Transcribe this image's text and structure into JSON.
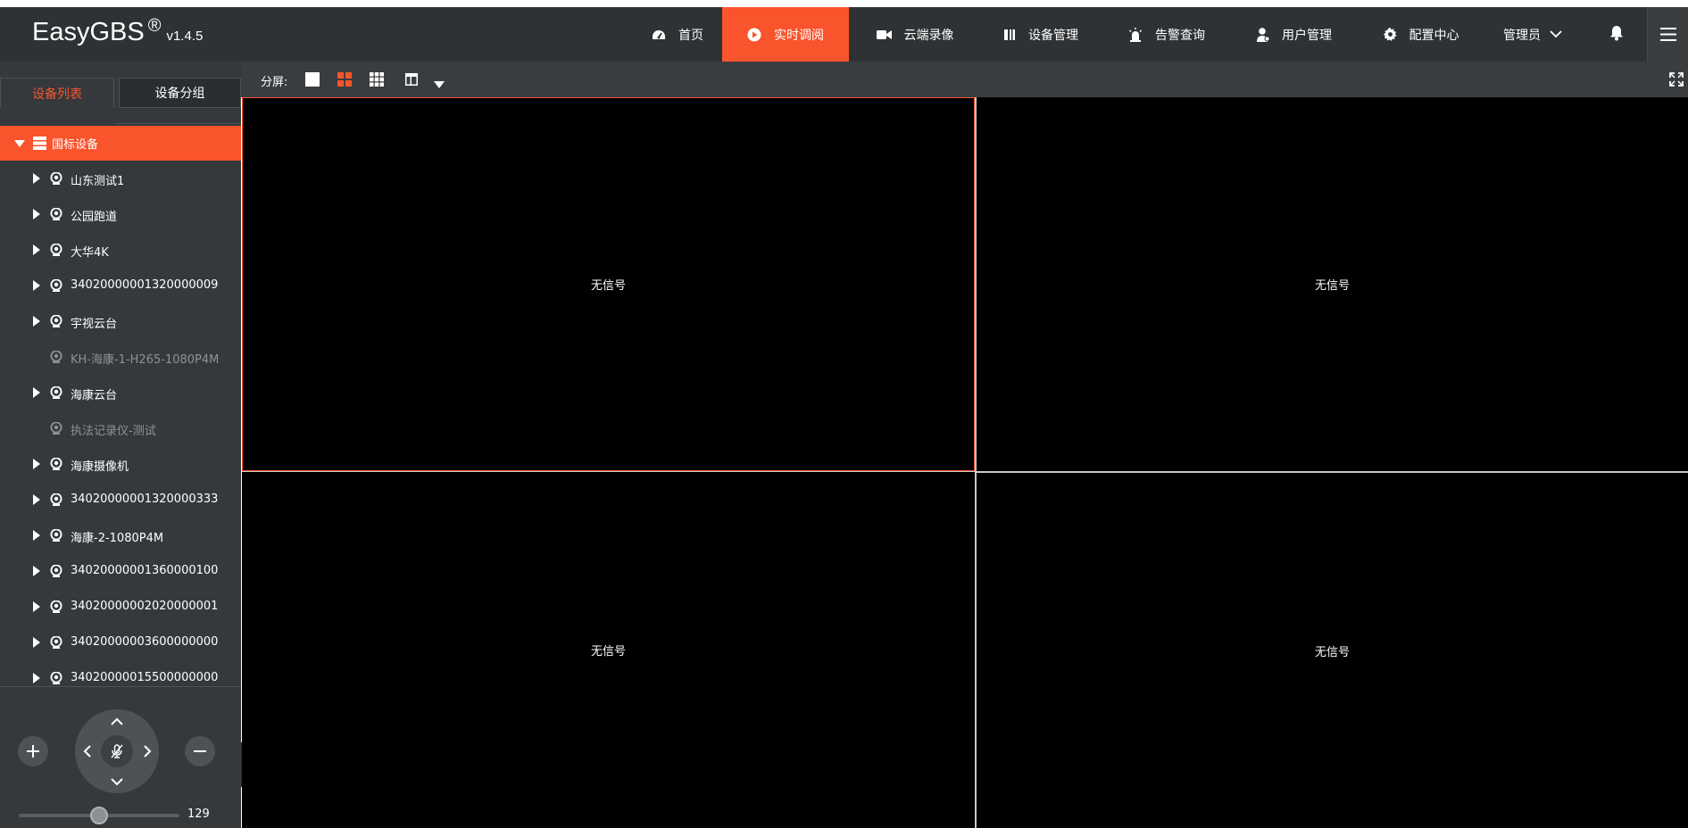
{
  "app": {
    "brand": "EasyGBS",
    "reg_mark": "®",
    "version": "v1.4.5"
  },
  "nav": [
    {
      "label": "首页",
      "icon": "dashboard-icon"
    },
    {
      "label": "实时调阅",
      "icon": "play-icon",
      "active": true
    },
    {
      "label": "云端录像",
      "icon": "video-camera-icon"
    },
    {
      "label": "设备管理",
      "icon": "device-icon"
    },
    {
      "label": "告警查询",
      "icon": "alarm-icon"
    },
    {
      "label": "用户管理",
      "icon": "user-icon"
    },
    {
      "label": "配置中心",
      "icon": "gear-icon"
    }
  ],
  "user": {
    "name": "管理员",
    "icon": "chevron-down-icon"
  },
  "colors": {
    "accent": "#f9542c",
    "header": "#2f3234",
    "sidebar": "#35393c"
  },
  "sidebar": {
    "tabs": [
      "设备列表",
      "设备分组"
    ],
    "root": "国标设备",
    "items": [
      {
        "label": "山东测试1",
        "expandable": true,
        "online": true
      },
      {
        "label": "公园跑道",
        "expandable": true,
        "online": true
      },
      {
        "label": "大华4K",
        "expandable": true,
        "online": true
      },
      {
        "label": "34020000001320000009",
        "expandable": true,
        "online": true
      },
      {
        "label": "宇视云台",
        "expandable": true,
        "online": true
      },
      {
        "label": "KH-海康-1-H265-1080P4M",
        "expandable": false,
        "online": false
      },
      {
        "label": "海康云台",
        "expandable": true,
        "online": true
      },
      {
        "label": "执法记录仪-测试",
        "expandable": false,
        "online": false
      },
      {
        "label": "海康摄像机",
        "expandable": true,
        "online": true
      },
      {
        "label": "34020000001320000333",
        "expandable": true,
        "online": true
      },
      {
        "label": "海康-2-1080P4M",
        "expandable": true,
        "online": true
      },
      {
        "label": "34020000001360000100",
        "expandable": true,
        "online": true
      },
      {
        "label": "34020000002020000001",
        "expandable": true,
        "online": true
      },
      {
        "label": "34020000003600000000",
        "expandable": true,
        "online": true
      },
      {
        "label": "34020000015500000000",
        "expandable": true,
        "online": true
      }
    ]
  },
  "ptz": {
    "speed": 129,
    "speed_fraction": 0.5
  },
  "toolbar": {
    "split_label": "分屏:"
  },
  "video": {
    "cells": [
      {
        "text": "无信号"
      },
      {
        "text": "无信号"
      },
      {
        "text": "无信号"
      },
      {
        "text": "无信号"
      }
    ]
  }
}
